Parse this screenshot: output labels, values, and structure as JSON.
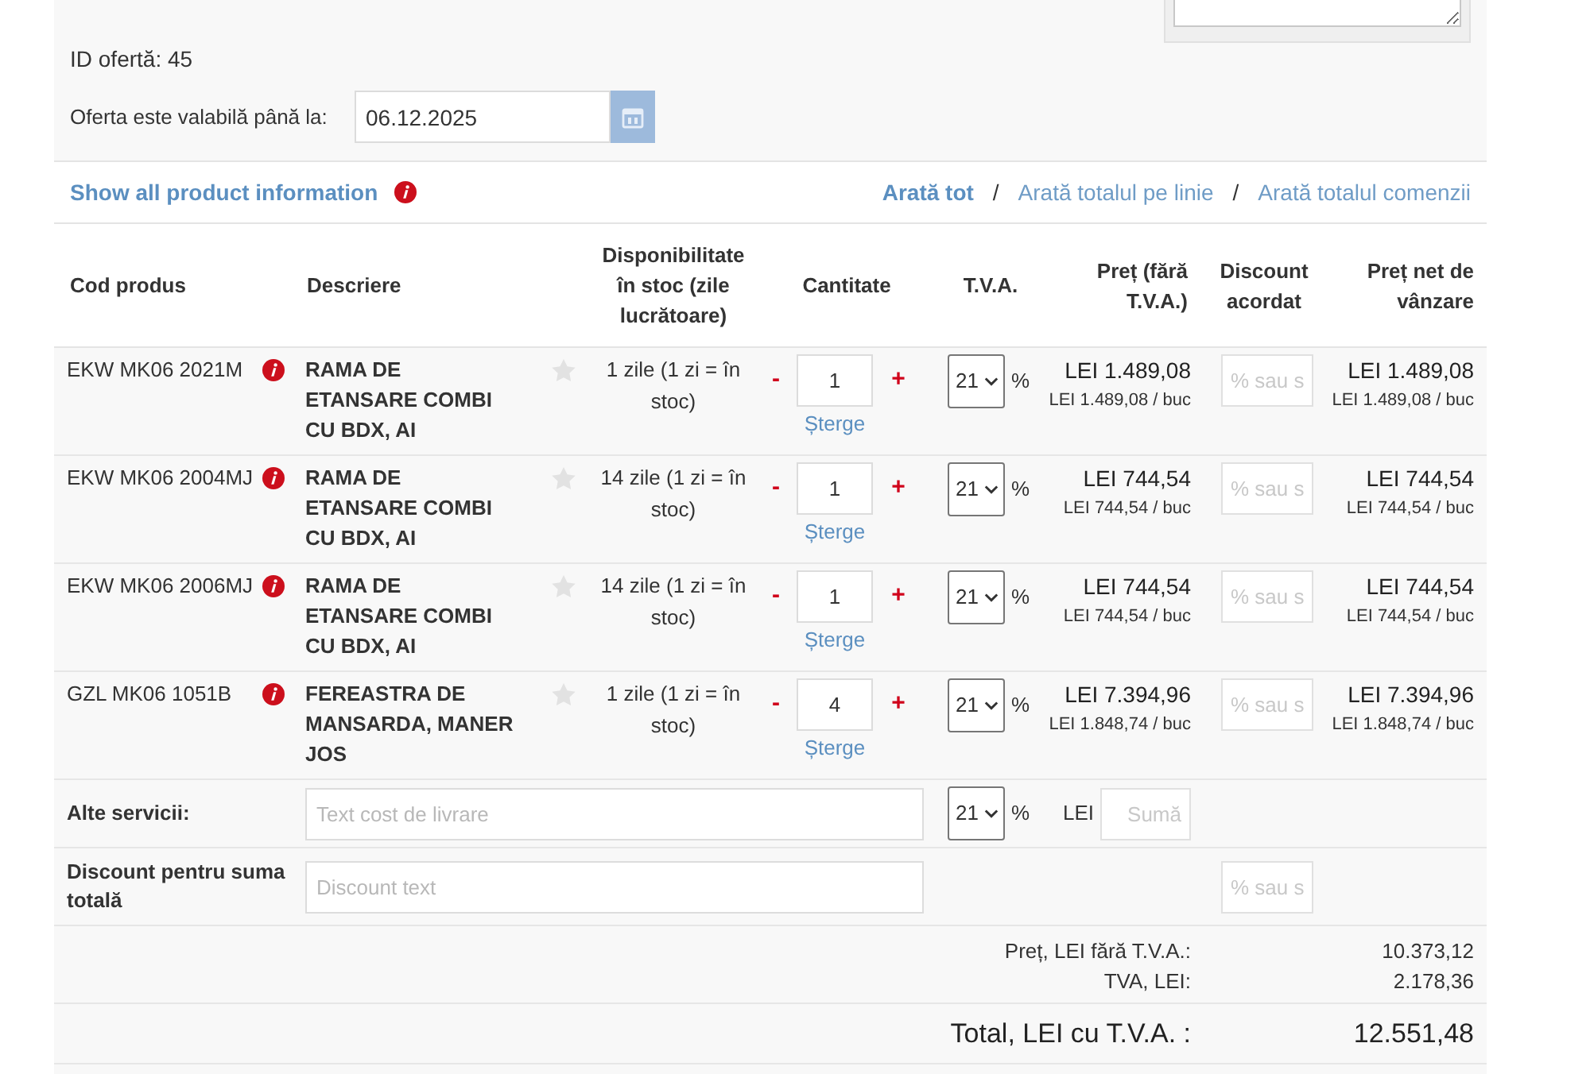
{
  "offer": {
    "id_label": "ID ofertă: 45",
    "validity_label": "Oferta este valabilă până la:",
    "valid_until": "06.12.2025"
  },
  "links": {
    "show_all": "Show all product information",
    "views": [
      {
        "label": "Arată tot",
        "selected": true
      },
      {
        "label": "Arată totalul pe linie",
        "selected": false
      },
      {
        "label": "Arată totalul comenzii",
        "selected": false
      }
    ],
    "separators": [
      "/",
      "/"
    ]
  },
  "table": {
    "columns": [
      "Cod produs",
      "Descriere",
      "Disponibilitate în stoc (zile lucrătoare)",
      "Cantitate",
      "T.V.A.",
      "Preț (fără T.V.A.)",
      "Discount acordat",
      "Preț net de vânzare"
    ],
    "rows": [
      {
        "code": "EKW MK06 2021M",
        "description": "RAMA DE ETANSARE COMBI CU BDX, AI",
        "starred": false,
        "availability": "1 zile (1 zi = în stoc)",
        "decrement": "-",
        "quantity": "1",
        "increment": "+",
        "delete": "Șterge",
        "vat": "21",
        "vat_unit": "%",
        "price": "LEI 1.489,08",
        "unit_price": "LEI 1.489,08 / buc",
        "discount_placeholder": "% sau s",
        "net_price": "LEI 1.489,08",
        "net_unit_price": "LEI 1.489,08 / buc"
      },
      {
        "code": "EKW MK06 2004MJ",
        "description": "RAMA DE ETANSARE COMBI CU BDX, AI",
        "starred": false,
        "availability": "14 zile (1 zi = în stoc)",
        "decrement": "-",
        "quantity": "1",
        "increment": "+",
        "delete": "Șterge",
        "vat": "21",
        "vat_unit": "%",
        "price": "LEI 744,54",
        "unit_price": "LEI 744,54 / buc",
        "discount_placeholder": "% sau s",
        "net_price": "LEI 744,54",
        "net_unit_price": "LEI 744,54 / buc"
      },
      {
        "code": "EKW MK06 2006MJ",
        "description": "RAMA DE ETANSARE COMBI CU BDX, AI",
        "starred": false,
        "availability": "14 zile (1 zi = în stoc)",
        "decrement": "-",
        "quantity": "1",
        "increment": "+",
        "delete": "Șterge",
        "vat": "21",
        "vat_unit": "%",
        "price": "LEI 744,54",
        "unit_price": "LEI 744,54 / buc",
        "discount_placeholder": "% sau s",
        "net_price": "LEI 744,54",
        "net_unit_price": "LEI 744,54 / buc"
      },
      {
        "code": "GZL MK06 1051B",
        "description": "FEREASTRA DE MANSARDA, MANER JOS",
        "starred": false,
        "availability": "1 zile (1 zi = în stoc)",
        "decrement": "-",
        "quantity": "4",
        "increment": "+",
        "delete": "Șterge",
        "vat": "21",
        "vat_unit": "%",
        "price": "LEI 7.394,96",
        "unit_price": "LEI 1.848,74 / buc",
        "discount_placeholder": "% sau s",
        "net_price": "LEI 7.394,96",
        "net_unit_price": "LEI 1.848,74 / buc"
      }
    ]
  },
  "extra_services": {
    "label": "Alte servicii:",
    "text_placeholder": "Text cost de livrare",
    "vat": "21",
    "vat_unit": "%",
    "currency": "LEI",
    "amount_placeholder": "Sumă"
  },
  "total_discount": {
    "label": "Discount pentru suma totală",
    "text_placeholder": "Discount text",
    "value_placeholder": "% sau s"
  },
  "summary": {
    "lines": [
      {
        "label": "Preț, LEI fără T.V.A.:",
        "value": "10.373,12"
      },
      {
        "label": "TVA, LEI:",
        "value": "2.178,36"
      }
    ],
    "total": {
      "label": "Total, LEI cu T.V.A. :",
      "value": "12.551,48"
    }
  }
}
